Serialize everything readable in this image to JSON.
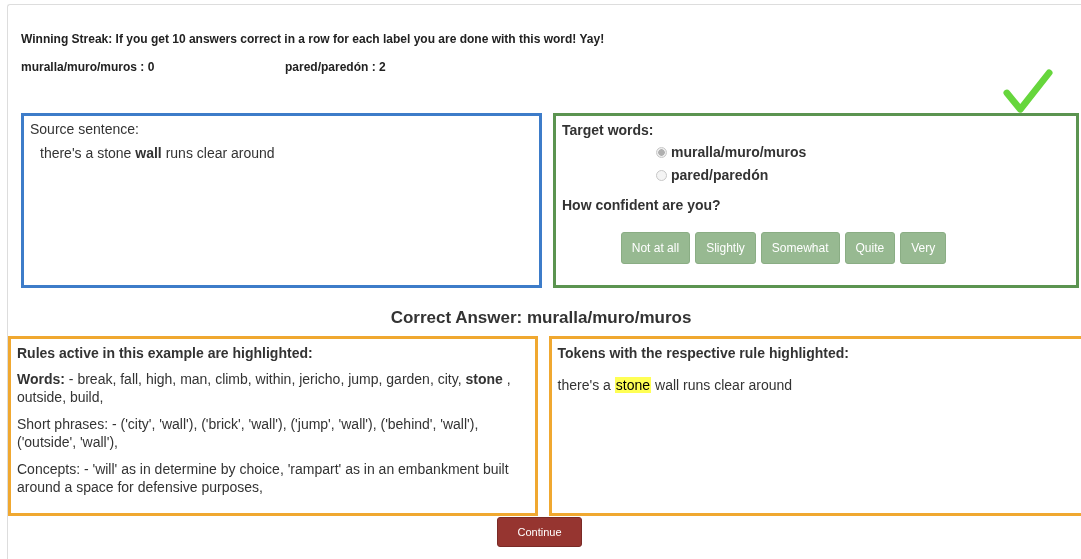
{
  "streak_note": "Winning Streak: If you get 10 answers correct in a row for each label you are done with this word! Yay!",
  "counts": [
    {
      "label": "muralla/muro/muros :",
      "value": "0"
    },
    {
      "label": "pared/paredón :",
      "value": "2"
    }
  ],
  "result": {
    "correct": true
  },
  "source": {
    "title": "Source sentence:",
    "sentence": "there's a stone **wall** runs clear around"
  },
  "target": {
    "title": "Target words:",
    "options": [
      {
        "label": "muralla/muro/muros",
        "selected": true
      },
      {
        "label": "pared/paredón",
        "selected": false
      }
    ],
    "confidence_title": "How confident are you?",
    "confidence_buttons": [
      "Not at all",
      "Slightly",
      "Somewhat",
      "Quite",
      "Very"
    ]
  },
  "correct_answer": "Correct Answer: muralla/muro/muros",
  "rules": {
    "title": "Rules active in this example are highlighted:",
    "items": [
      "**Words:** - break, fall, high, man, climb, within, jericho, jump, garden, city, **stone** , outside, build,",
      "Short phrases: - ('city', 'wall'), ('brick', 'wall'), ('jump', 'wall'), ('behind', 'wall'), ('outside', 'wall'),",
      "Concepts: - 'will' as in determine by choice, 'rampart' as in an embankment built around a space for defensive purposes,"
    ]
  },
  "tokens": {
    "title": "Tokens with the respective rule highlighted:",
    "words": [
      {
        "text": "there's a",
        "highlighted": false
      },
      {
        "text": "stone",
        "highlighted": true
      },
      {
        "text": "wall runs clear around",
        "highlighted": false
      }
    ]
  },
  "continue_button": "Continue"
}
